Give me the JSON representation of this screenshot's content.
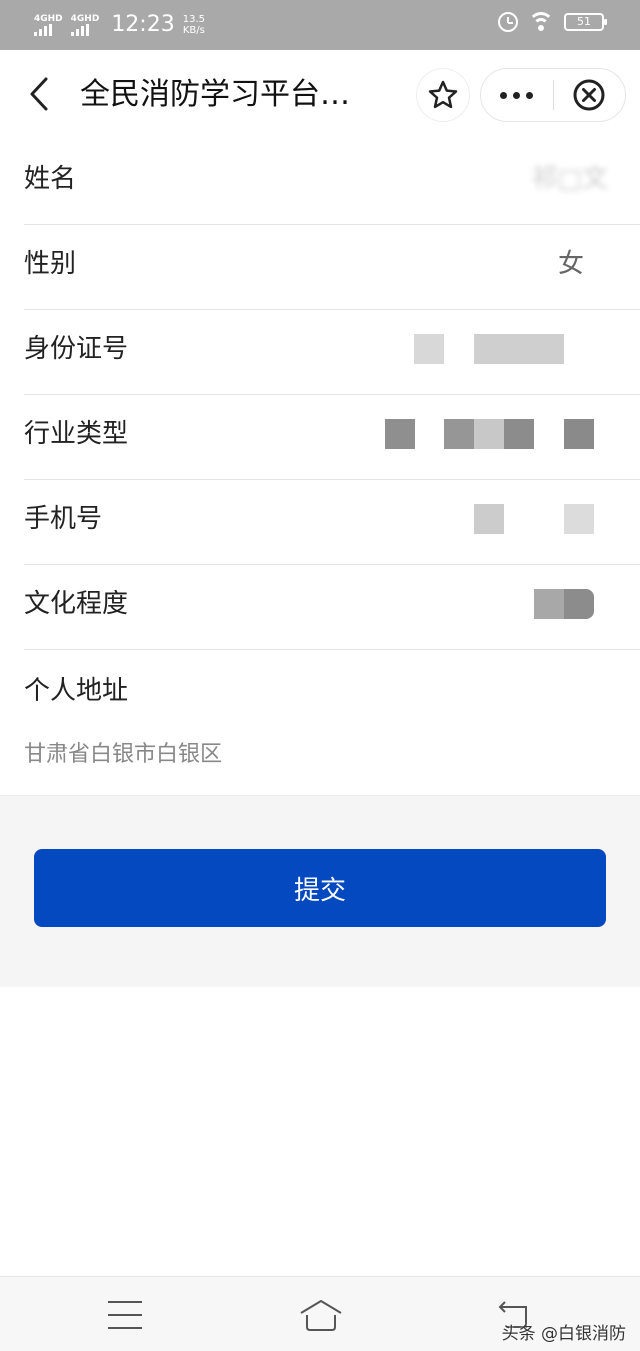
{
  "status_bar": {
    "network_1": "4GHD",
    "network_2": "4GHD",
    "time": "12:23",
    "speed_value": "13.5",
    "speed_unit": "KB/s",
    "battery": "51",
    "icons": [
      "signal-icon",
      "alarm-icon",
      "wifi-icon",
      "battery-icon"
    ]
  },
  "title_bar": {
    "title": "全民消防学习平台…",
    "icons": [
      "back-icon",
      "star-icon",
      "more-icon",
      "close-icon"
    ]
  },
  "form": {
    "name": {
      "label": "姓名",
      "value": "祁□文"
    },
    "gender": {
      "label": "性别",
      "value": "女"
    },
    "id_number": {
      "label": "身份证号"
    },
    "industry": {
      "label": "行业类型"
    },
    "phone": {
      "label": "手机号"
    },
    "education": {
      "label": "文化程度"
    },
    "address": {
      "label": "个人地址",
      "value": "甘肃省白银市白银区"
    }
  },
  "submit": {
    "label": "提交"
  },
  "nav_bar": {
    "icons": [
      "menu-icon",
      "home-icon",
      "back-nav-icon"
    ],
    "watermark": "头条 @白银消防"
  },
  "colors": {
    "status_bar_bg": "#a9a9a9",
    "accent": "#0449bf",
    "submit_area_bg": "#f5f5f5"
  }
}
